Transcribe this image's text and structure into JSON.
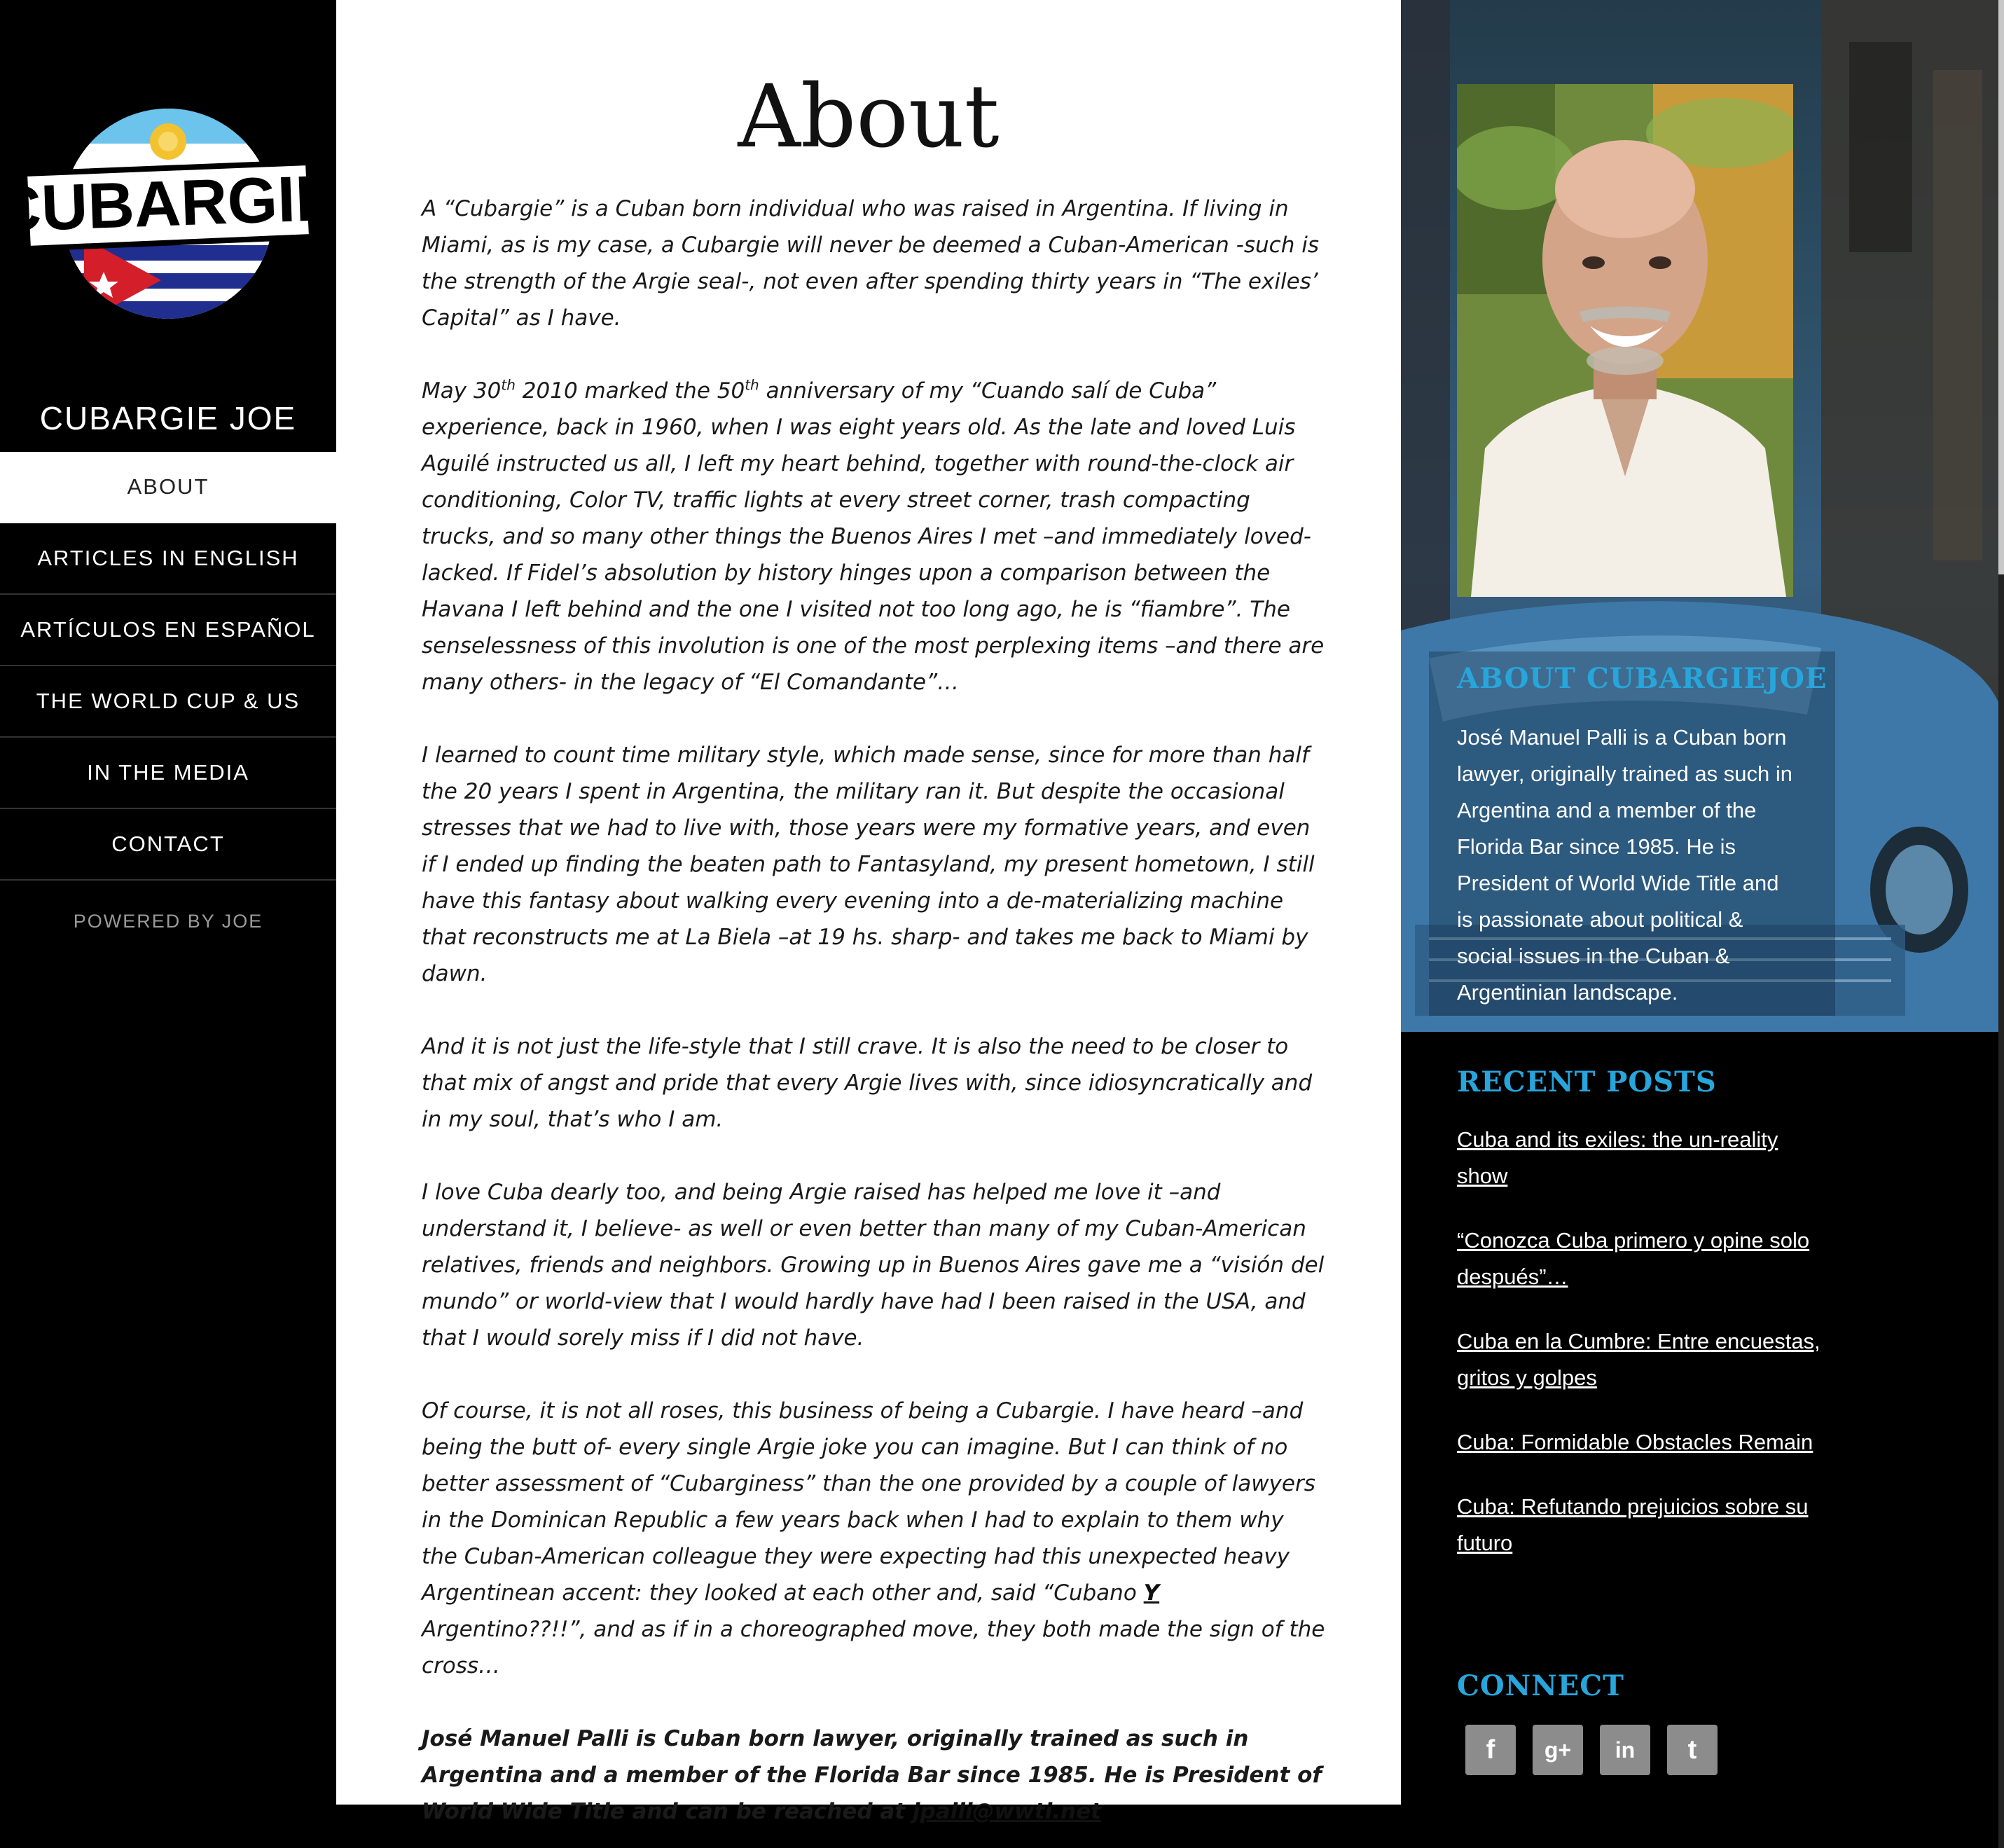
{
  "brand": {
    "logo_text": "CUBARGIE",
    "site_title": "CUBARGIE JOE"
  },
  "nav": {
    "items": [
      {
        "label": "ABOUT",
        "active": true
      },
      {
        "label": "ARTICLES IN ENGLISH",
        "active": false
      },
      {
        "label": "ARTÍCULOS EN ESPAÑOL",
        "active": false
      },
      {
        "label": "THE WORLD CUP & US",
        "active": false
      },
      {
        "label": "IN THE MEDIA",
        "active": false
      },
      {
        "label": "CONTACT",
        "active": false
      }
    ],
    "powered_by": "POWERED BY JOE"
  },
  "main": {
    "title": "About",
    "p1": "A “Cubargie” is a Cuban born individual who was raised in Argentina. If living in Miami, as is my case, a Cubargie will never be deemed a Cuban-American -such is the strength of the Argie seal-, not even after spending thirty years in “The exiles’ Capital” as I have.",
    "p2_a": "May 30",
    "p2_sup1": "th",
    "p2_b": " 2010 marked the 50",
    "p2_sup2": "th",
    "p2_c": " anniversary of my “Cuando salí de Cuba” experience, back in 1960, when I was eight years old.  As the late and loved Luis Aguilé instructed us all, I left my heart behind, together with round-the-clock air conditioning, Color TV, traffic lights at every street corner, trash compacting trucks, and so many other things the Buenos Aires I met –and immediately loved- lacked. If Fidel’s absolution by history hinges upon a comparison between the Havana I left behind and the one I visited not too long ago, he is “fiambre”. The senselessness of this involution is one of the most perplexing items –and there are many others- in the legacy of “El Comandante”…",
    "p3": "I learned to count time military style, which made sense, since for more than half the 20 years I spent in Argentina, the military ran it. But despite the occasional stresses that we had to live with, those years were my formative years, and even if I ended up finding the beaten path to Fantasyland, my present hometown, I still have this fantasy about walking every evening into a de-materializing machine that reconstructs me at La Biela –at 19 hs. sharp- and takes me back to Miami by dawn.",
    "p4": "And it is not just the life-style that I still crave. It is also the need to be closer to that mix of angst and pride that every Argie lives with, since idiosyncratically and in my soul, that’s who I am.",
    "p5": "I love Cuba dearly too, and being Argie raised has helped me love it –and understand it, I believe- as well or even better than many of my Cuban-American relatives, friends and neighbors. Growing up in Buenos Aires gave me a “visión del mundo” or world-view that I would hardly have had I been raised in the USA, and that I would sorely miss if I did not have.",
    "p6_a": "Of course, it is not all roses, this business of being a Cubargie. I have heard –and being the butt of- every single Argie joke you can imagine. But I can think of no better assessment of “Cubarginess” than the one provided by a couple of lawyers in the Dominican Republic a few years back when I had to explain to them why the Cuban-American colleague they were expecting had this unexpected heavy Argentinean accent: they looked at each other and, said “Cubano ",
    "p6_y": "Y",
    "p6_b": " Argentino??!!”, and as if in a choreographed move, they both made the sign of the cross…",
    "p7_text": "José Manuel Palli is Cuban born lawyer, originally trained as such in Argentina and a member of the Florida Bar since 1985. He is President of World Wide Title and can be reached at  ",
    "p7_email": "jpalli@wwti.net"
  },
  "sidebar": {
    "about_heading": "ABOUT CUBARGIEJOE",
    "about_text": "José Manuel Palli is a Cuban born lawyer, originally trained as such in Argentina and a member of the Florida Bar since 1985. He is President of World Wide Title and is passionate about political & social issues in the Cuban & Argentinian landscape.",
    "recent_heading": "RECENT POSTS",
    "recent_posts": [
      "Cuba and its exiles: the un-reality show",
      "“Conozca Cuba primero y opine solo después”…",
      "Cuba en la Cumbre: Entre encuestas, gritos y golpes",
      "Cuba: Formidable Obstacles Remain",
      "Cuba: Refutando prejuicios sobre su futuro"
    ],
    "connect_heading": "CONNECT",
    "social": [
      {
        "icon": "facebook-icon",
        "glyph": "f"
      },
      {
        "icon": "google-plus-icon",
        "glyph": "g+"
      },
      {
        "icon": "linkedin-icon",
        "glyph": "in"
      },
      {
        "icon": "twitter-icon",
        "glyph": "t"
      }
    ]
  },
  "colors": {
    "accent": "#27a6dc",
    "sidebar_bg": "#000000",
    "content_bg": "#ffffff",
    "social_btn": "#8c8c8c"
  }
}
